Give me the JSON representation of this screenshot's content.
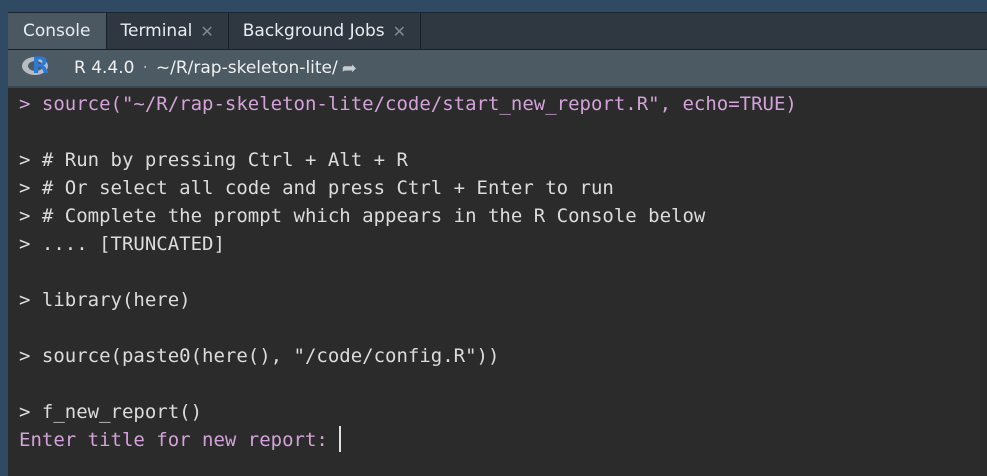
{
  "tabs": [
    {
      "label": "Console",
      "active": true,
      "closable": false
    },
    {
      "label": "Terminal",
      "closable": true
    },
    {
      "label": "Background Jobs",
      "closable": true
    }
  ],
  "toolbar": {
    "r_version": "R 4.4.0",
    "separator": "·",
    "path": "~/R/rap-skeleton-lite/",
    "icons": [
      "r-logo-icon",
      "go-to-directory-icon"
    ]
  },
  "console": {
    "lines": [
      "> source(\"~/R/rap-skeleton-lite/code/start_new_report.R\", echo=TRUE)",
      "",
      "> # Run by pressing Ctrl + Alt + R",
      "> # Or select all code and press Ctrl + Enter to run",
      "> # Complete the prompt which appears in the R Console below",
      "> .... [TRUNCATED]",
      "",
      "> library(here)",
      "",
      "> source(paste0(here(), \"/code/config.R\"))",
      "",
      "> f_new_report()"
    ],
    "prompt": "Enter title for new report: ",
    "input_value": ""
  },
  "colors": {
    "echo": "#d3a2d9",
    "text": "#dcdcdc",
    "background": "#2b2b2b"
  }
}
